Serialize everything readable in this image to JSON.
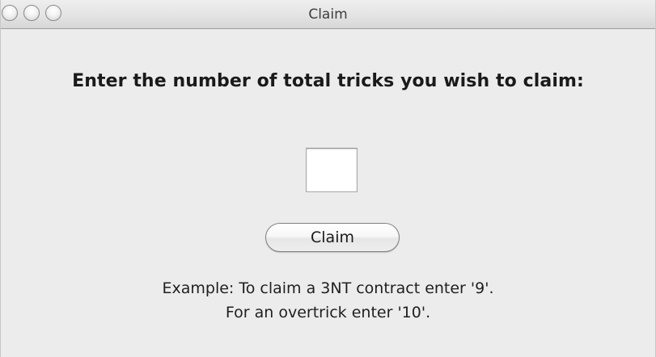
{
  "window": {
    "title": "Claim"
  },
  "dialog": {
    "prompt": "Enter the number of total tricks you wish to claim:",
    "tricks_input": {
      "value": "",
      "placeholder": ""
    },
    "claim_button_label": "Claim",
    "example_line_1": "Example: To claim a 3NT contract enter '9'.",
    "example_line_2": "For an overtrick enter '10'."
  }
}
